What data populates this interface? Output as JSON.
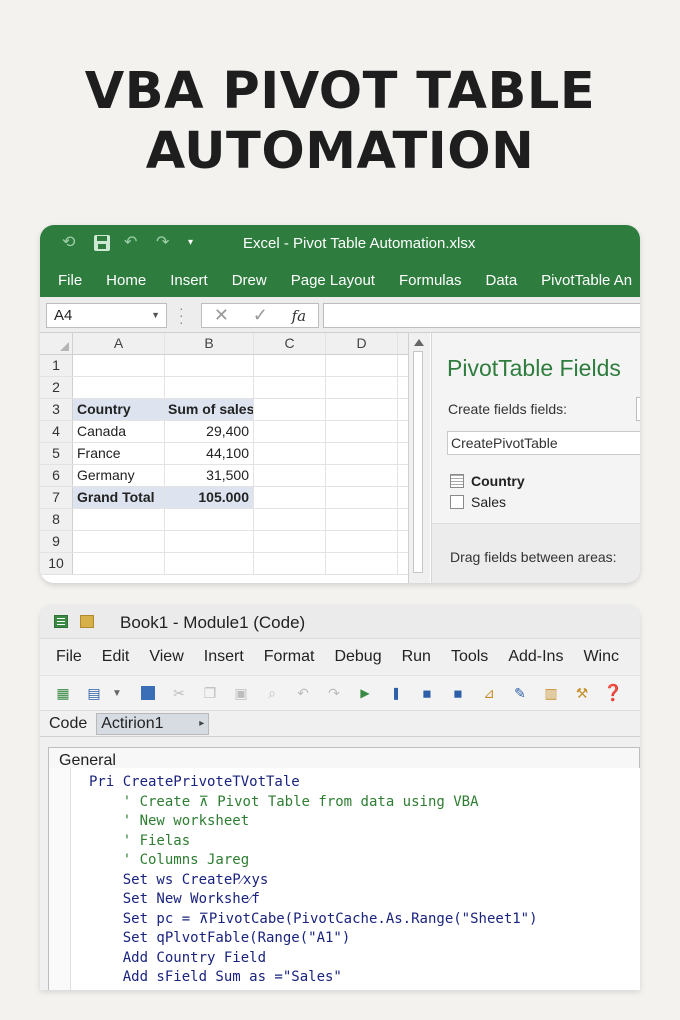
{
  "headline": {
    "line1": "VBA PIVOT TABLE",
    "line2": "AUTOMATION"
  },
  "excel": {
    "window_title": "Excel - Pivot Table Automation.xlsx",
    "menu": [
      "File",
      "Home",
      "Insert",
      "Drew",
      "Page Layout",
      "Formulas",
      "Data",
      "PivotTable An"
    ],
    "name_box": "A4",
    "formula_buttons": {
      "cancel": "✕",
      "enter": "✓",
      "fx": "fa"
    },
    "columns": [
      "A",
      "B",
      "C",
      "D"
    ],
    "rows": [
      {
        "n": "1",
        "a": "",
        "b": ""
      },
      {
        "n": "2",
        "a": "",
        "b": ""
      },
      {
        "n": "3",
        "a": "Country",
        "b": "Sum of sales"
      },
      {
        "n": "4",
        "a": "Canada",
        "b": "29,400"
      },
      {
        "n": "5",
        "a": "France",
        "b": "44,100"
      },
      {
        "n": "6",
        "a": "Germany",
        "b": "31,500"
      },
      {
        "n": "7",
        "a": "Grand Total",
        "b": "105.000"
      },
      {
        "n": "8",
        "a": "",
        "b": ""
      },
      {
        "n": "9",
        "a": "",
        "b": ""
      },
      {
        "n": "10",
        "a": "",
        "b": ""
      }
    ],
    "pivot_panel": {
      "title": "PivotTable Fields",
      "label": "Create fields fields:",
      "search_value": "CreatePivotTable",
      "fields": [
        {
          "label": "Country",
          "checked": true
        },
        {
          "label": "Sales",
          "checked": false
        }
      ],
      "drag_text": "Drag fields between areas:"
    },
    "accent_color": "#2e7d3e"
  },
  "vba": {
    "window_title": "Book1 - Module1 (Code)",
    "menu": [
      "File",
      "Edit",
      "View",
      "Insert",
      "Format",
      "Debug",
      "Run",
      "Tools",
      "Add-Ins",
      "Winc"
    ],
    "toolbar_icons": [
      "excel-icon",
      "insert-userform-icon",
      "save-icon",
      "cut-icon",
      "copy-icon",
      "paste-icon",
      "find-icon",
      "undo-icon",
      "redo-icon",
      "run-icon",
      "break-icon",
      "reset-icon",
      "design-mode-icon",
      "project-explorer-icon",
      "properties-icon",
      "object-browser-icon",
      "toolbox-icon",
      "help-icon"
    ],
    "object_label": "Code",
    "procedure_dropdown": "Actirion1",
    "general_dropdown": "General",
    "code_lines": [
      "Pri CreatePrivoteTVotTale",
      "    ' Create ⊼ Pivot Table from data using VBA",
      "    ' New worksheet",
      "    ' Fielas",
      "    ' Columns Jareg",
      "    Set ws CreateP⁄xys",
      "    Set New Workshe⁄f",
      "    Set pc = ⊼PivotCabe(PivotCache.As.Range(\"Sheet1\")",
      "    Set qPlvotFable(Range(\"A1\")",
      "    Add Country Field",
      "    Add sField Sum as =\"Sales\""
    ]
  }
}
